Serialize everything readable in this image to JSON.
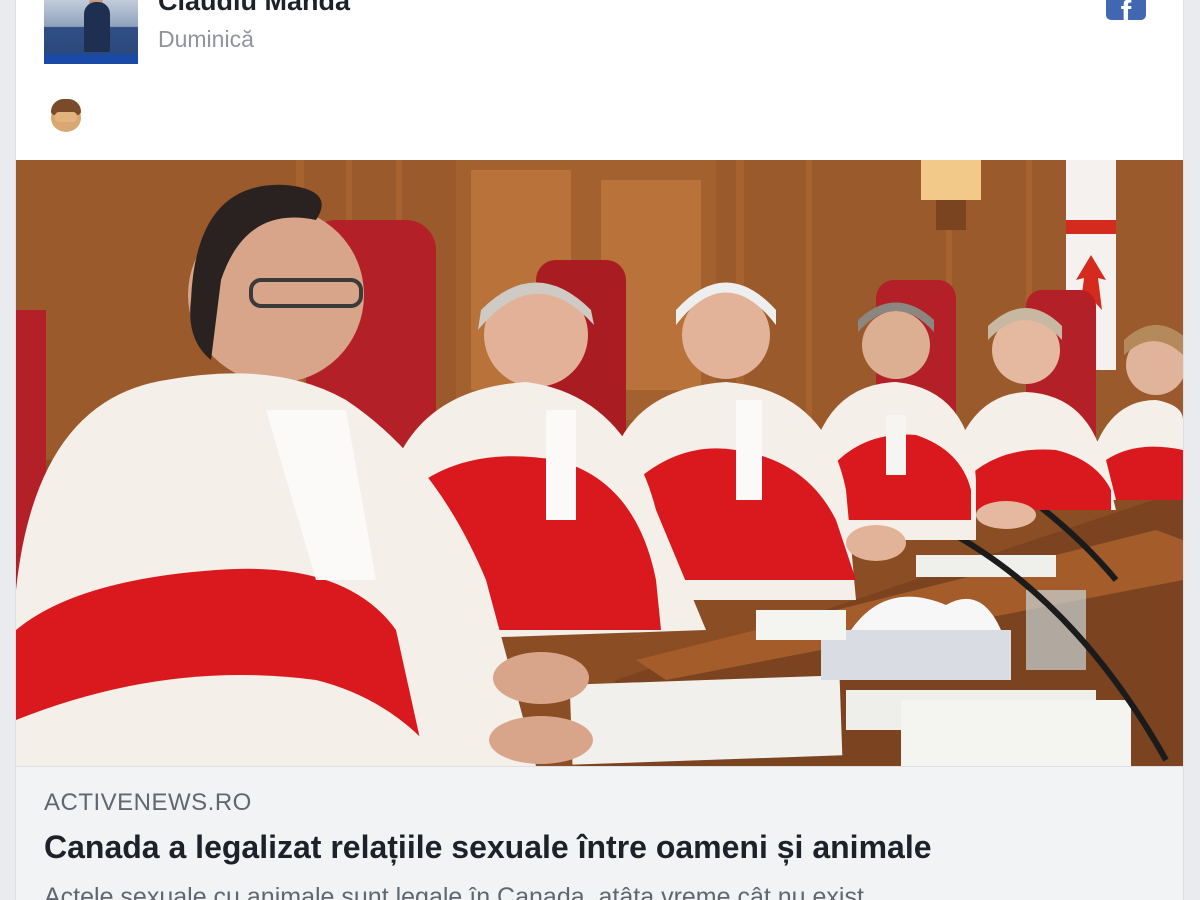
{
  "post": {
    "author_name": "Claudiu Manda",
    "date": "Duminică",
    "icon": "facebook-icon",
    "reaction_emoji": "monkey-see-no-evil-emoji"
  },
  "link_preview": {
    "domain": "ACTIVENEWS.RO",
    "headline": "Canada a legalizat relațiile sexuale între oameni și animale",
    "snippet": "Actele sexuale cu animale sunt legale în Canada, atâta vreme cât nu exist"
  },
  "colors": {
    "facebook_blue": "#4267b2",
    "robe_red": "#d9191d",
    "fur_white": "#f4efe8",
    "wood": "#9a5a2c"
  }
}
